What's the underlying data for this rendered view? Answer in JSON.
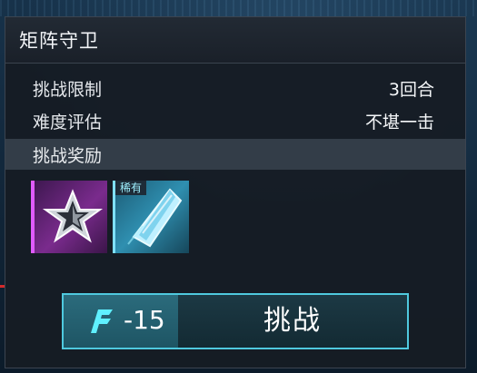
{
  "panel": {
    "title": "矩阵守卫"
  },
  "info": {
    "limit_label": "挑战限制",
    "limit_value": "3回合",
    "difficulty_label": "难度评估",
    "difficulty_value": "不堪一击"
  },
  "rewards": {
    "title": "挑战奖励",
    "items": [
      {
        "icon": "silver-star-icon",
        "rarity_color": "#c94be8"
      },
      {
        "icon": "blue-crystal-shard-icon",
        "rarity_color": "#4fc9de",
        "tag": "稀有"
      }
    ]
  },
  "challenge_button": {
    "cost": "-15",
    "cost_icon": "stamina-icon",
    "label": "挑战"
  },
  "colors": {
    "accent": "#4fc9de",
    "panel_bg": "#161c24",
    "band_bg": "#3e4854"
  }
}
